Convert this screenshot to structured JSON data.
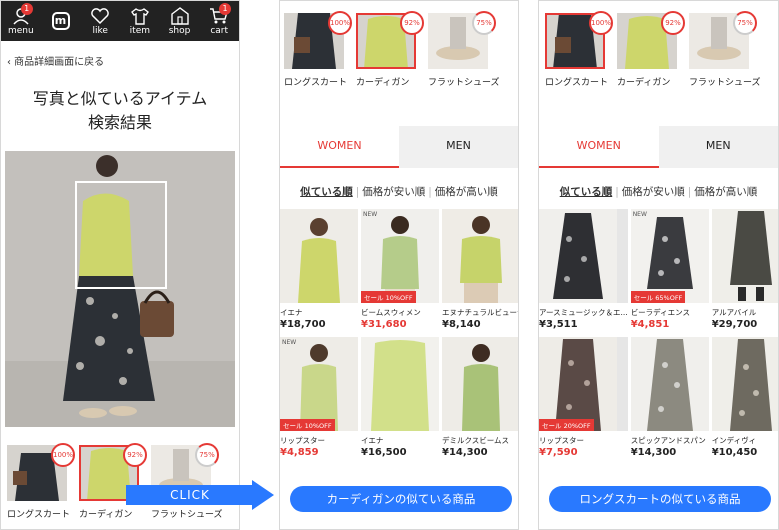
{
  "screen1": {
    "nav": [
      {
        "label": "menu",
        "icon": "user-icon",
        "badge": "1"
      },
      {
        "label": "",
        "icon": "logo-icon",
        "logo": "m"
      },
      {
        "label": "like",
        "icon": "heart-icon"
      },
      {
        "label": "item",
        "icon": "shirt-icon"
      },
      {
        "label": "shop",
        "icon": "shop-icon"
      },
      {
        "label": "cart",
        "icon": "cart-icon",
        "badge": "1"
      }
    ],
    "back_link": "‹ 商品詳細画面に戻る",
    "title_line1": "写真と似ているアイテム",
    "title_line2": "検索結果",
    "thumbs": [
      {
        "label": "ロングスカート",
        "pct": "100%"
      },
      {
        "label": "カーディガン",
        "pct": "92%"
      },
      {
        "label": "フラットシューズ",
        "pct": "75%"
      }
    ],
    "click_label": "CLICK"
  },
  "screen2": {
    "thumbs": [
      {
        "label": "ロングスカート",
        "pct": "100%"
      },
      {
        "label": "カーディガン",
        "pct": "92%"
      },
      {
        "label": "フラットシューズ",
        "pct": "75%"
      }
    ],
    "tabs": [
      "WOMEN",
      "MEN"
    ],
    "sort": [
      "似ている順",
      "価格が安い順",
      "価格が高い順"
    ],
    "products": [
      {
        "brand": "イエナ",
        "price": "¥18,700",
        "sale": "",
        "new": ""
      },
      {
        "brand": "ビームスウィメン",
        "price": "¥31,680",
        "sale": "セール 10%OFF",
        "new": "NEW"
      },
      {
        "brand": "エヌナチュラルビューティ...",
        "price": "¥8,140",
        "sale": "",
        "new": ""
      },
      {
        "brand": "リップスター",
        "price": "¥4,859",
        "sale": "セール 10%OFF",
        "new": "NEW"
      },
      {
        "brand": "イエナ",
        "price": "¥16,500",
        "sale": "",
        "new": ""
      },
      {
        "brand": "デミルクスビームス",
        "price": "¥14,300",
        "sale": "",
        "new": ""
      }
    ],
    "pill": "カーディガンの似ている商品"
  },
  "screen3": {
    "thumbs": [
      {
        "label": "ロングスカート",
        "pct": "100%"
      },
      {
        "label": "カーディガン",
        "pct": "92%"
      },
      {
        "label": "フラットシューズ",
        "pct": "75%"
      }
    ],
    "tabs": [
      "WOMEN",
      "MEN"
    ],
    "sort": [
      "似ている順",
      "価格が安い順",
      "価格が高い順"
    ],
    "products": [
      {
        "brand": "アースミュージック＆エ...",
        "price": "¥3,511",
        "sale": "",
        "new": ""
      },
      {
        "brand": "ビーラディエンス",
        "price": "¥4,851",
        "sale": "セール 65%OFF",
        "new": "NEW"
      },
      {
        "brand": "アルアバイル",
        "price": "¥29,700",
        "sale": "",
        "new": ""
      },
      {
        "brand": "リップスター",
        "price": "¥7,590",
        "sale": "セール 20%OFF",
        "new": ""
      },
      {
        "brand": "スピックアンドスパン",
        "price": "¥14,300",
        "sale": "",
        "new": ""
      },
      {
        "brand": "インディヴィ",
        "price": "¥10,450",
        "sale": "",
        "new": ""
      }
    ],
    "pill": "ロングスカートの似ている商品"
  },
  "colors": {
    "accent": "#e53935",
    "pill": "#2979ff",
    "nav": "#222222"
  }
}
